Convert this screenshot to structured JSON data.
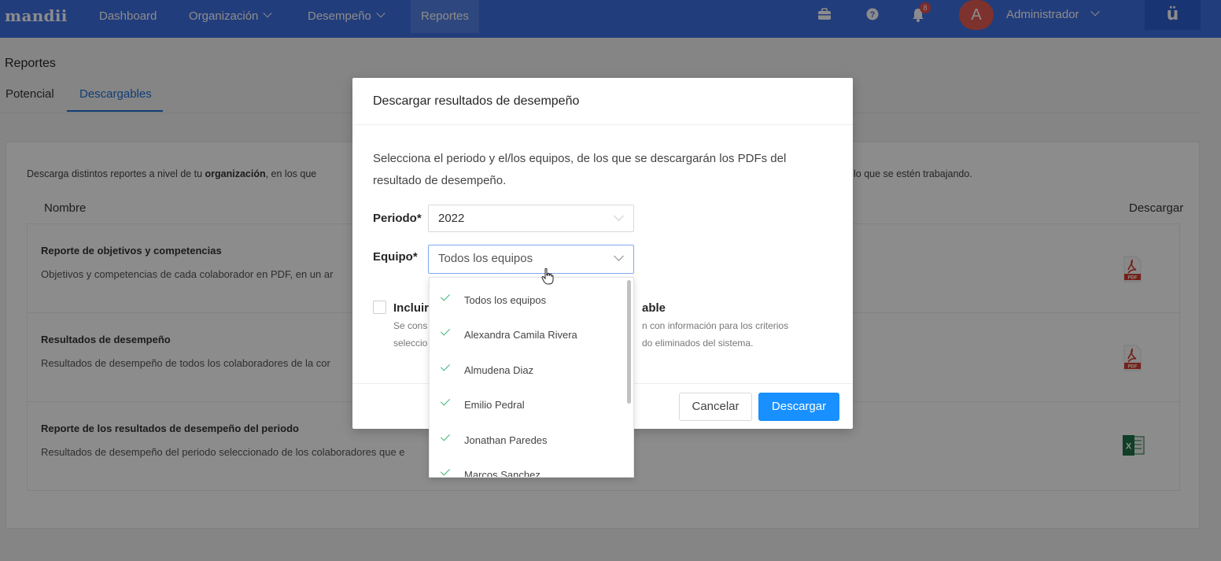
{
  "navbar": {
    "brand": "mandii",
    "items": [
      {
        "label": "Dashboard"
      },
      {
        "label": "Organización"
      },
      {
        "label": "Desempeño"
      },
      {
        "label": "Reportes"
      }
    ],
    "notification_count": "8",
    "avatar_letter": "A",
    "user_name": "Administrador",
    "logo_letter": "ü",
    "icons": [
      "briefcase-icon",
      "help-icon",
      "bell-icon"
    ]
  },
  "page": {
    "title": "Reportes",
    "tabs": [
      {
        "label": "Potencial"
      },
      {
        "label": "Descargables"
      }
    ],
    "intro_prefix": "Descarga distintos reportes a nivel de tu ",
    "intro_bold": "organización",
    "intro_suffix": ", en los que",
    "intro_right": "lo que se estén trabajando.",
    "col_name": "Nombre",
    "col_download": "Descargar",
    "reports": [
      {
        "title": "Reporte de objetivos y competencias",
        "desc": "Objetivos y competencias de cada colaborador en PDF, en un ar",
        "file": "pdf"
      },
      {
        "title": "Resultados de desempeño",
        "desc": "Resultados de desempeño de todos los colaboradores de la cor",
        "file": "pdf"
      },
      {
        "title": "Reporte de los resultados de desempeño del periodo",
        "desc": "Resultados de desempeño del periodo seleccionado de los colaboradores que e",
        "file": "xls"
      }
    ]
  },
  "modal": {
    "title": "Descargar resultados de desempeño",
    "body": "Selecciona el periodo y el/los equipos, de los que se descargarán los PDFs del resultado de desempeño.",
    "period_label": "Periodo*",
    "period_value": "2022",
    "team_label": "Equipo*",
    "team_placeholder": "Todos los equipos",
    "checkbox_title_a": "Incluir",
    "checkbox_title_b": "able",
    "checkbox_desc_a1": "Se cons",
    "checkbox_desc_a2": "seleccio",
    "checkbox_desc_b1": "n con información para los criterios",
    "checkbox_desc_b2": "do eliminados del sistema.",
    "cancel_label": "Cancelar",
    "download_label": "Descargar"
  },
  "dropdown": {
    "options": [
      {
        "label": "Todos los equipos",
        "checked": true
      },
      {
        "label": "Alexandra Camila Rivera",
        "checked": true
      },
      {
        "label": "Almudena Diaz",
        "checked": true
      },
      {
        "label": "Emilio Pedral",
        "checked": true
      },
      {
        "label": "Jonathan Paredes",
        "checked": true
      },
      {
        "label": "Marcos Sanchez",
        "checked": true
      }
    ]
  },
  "colors": {
    "navbar": "#3e6fe2",
    "primary": "#1890ff",
    "link": "#1f6fd8",
    "check": "#3cb87a"
  }
}
